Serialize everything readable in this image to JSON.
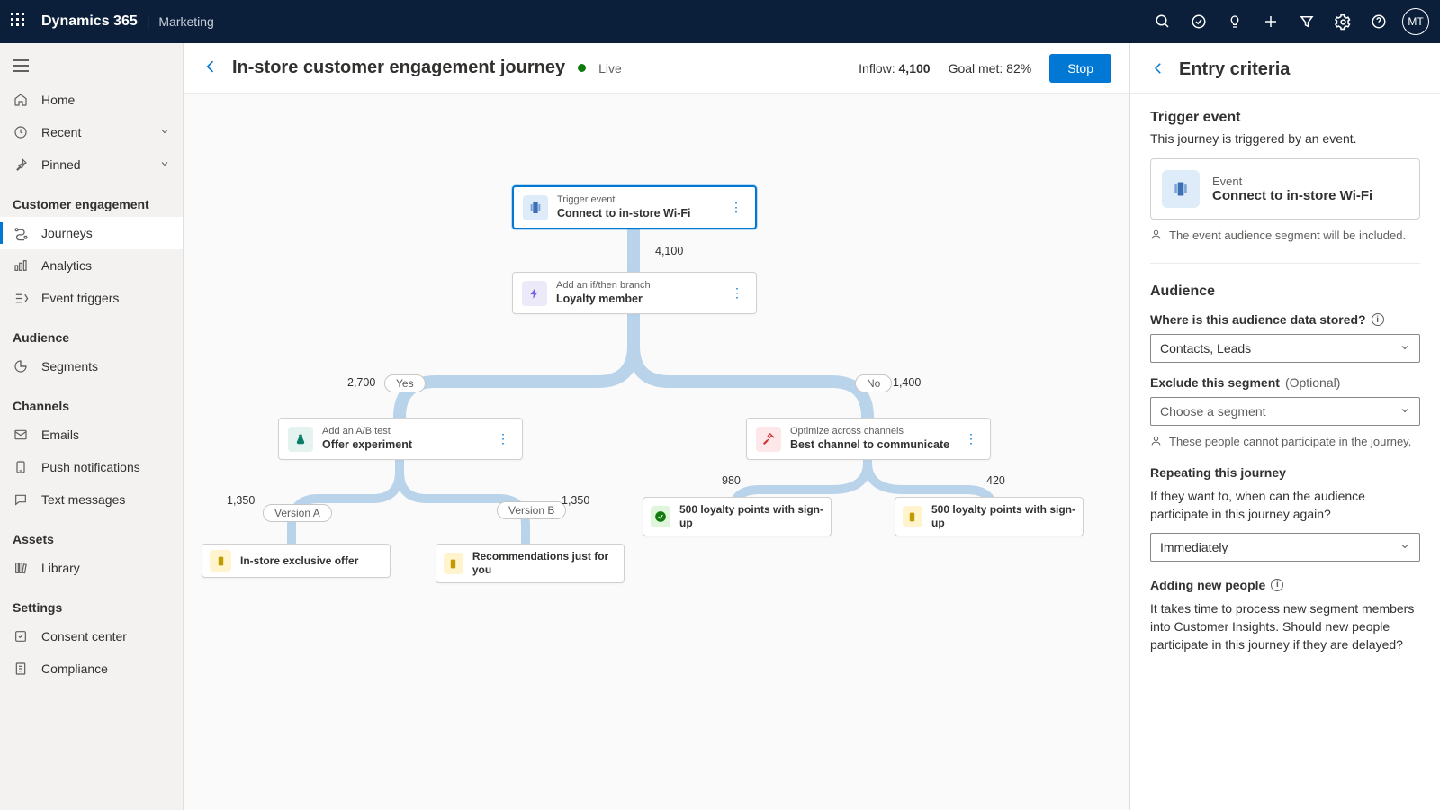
{
  "topbar": {
    "brand": "Dynamics 365",
    "subbrand": "Marketing",
    "avatar": "MT"
  },
  "sidebar": {
    "top": [
      {
        "id": "home",
        "label": "Home"
      },
      {
        "id": "recent",
        "label": "Recent",
        "expandable": true
      },
      {
        "id": "pinned",
        "label": "Pinned",
        "expandable": true
      }
    ],
    "sections": [
      {
        "title": "Customer engagement",
        "items": [
          {
            "id": "journeys",
            "label": "Journeys",
            "active": true
          },
          {
            "id": "analytics",
            "label": "Analytics"
          },
          {
            "id": "triggers",
            "label": "Event triggers"
          }
        ]
      },
      {
        "title": "Audience",
        "items": [
          {
            "id": "segments",
            "label": "Segments"
          }
        ]
      },
      {
        "title": "Channels",
        "items": [
          {
            "id": "emails",
            "label": "Emails"
          },
          {
            "id": "push",
            "label": "Push notifications"
          },
          {
            "id": "text",
            "label": "Text messages"
          }
        ]
      },
      {
        "title": "Assets",
        "items": [
          {
            "id": "library",
            "label": "Library"
          }
        ]
      },
      {
        "title": "Settings",
        "items": [
          {
            "id": "consent",
            "label": "Consent center"
          },
          {
            "id": "compliance",
            "label": "Compliance"
          }
        ]
      }
    ]
  },
  "cmdbar": {
    "title": "In-store customer engagement journey",
    "status": "Live",
    "inflow_label": "Inflow:",
    "inflow_value": "4,100",
    "goal_label": "Goal met:",
    "goal_value": "82%",
    "stop": "Stop"
  },
  "canvas": {
    "nodes": {
      "trigger": {
        "type": "Trigger event",
        "title": "Connect to in-store Wi-Fi"
      },
      "cond": {
        "type": "Add an if/then branch",
        "title": "Loyalty member"
      },
      "ab": {
        "type": "Add an A/B test",
        "title": "Offer experiment"
      },
      "opt": {
        "type": "Optimize across channels",
        "title": "Best channel to communicate"
      },
      "va": {
        "title": "In-store exclusive offer"
      },
      "vb": {
        "title": "Recommendations just for you"
      },
      "loy1": {
        "title": "500 loyalty points with sign-up"
      },
      "loy2": {
        "title": "500 loyalty points with sign-up"
      }
    },
    "pills": {
      "yes": "Yes",
      "no": "No",
      "va": "Version A",
      "vb": "Version B"
    },
    "nums": {
      "root": "4,100",
      "yes": "2,700",
      "no": "1,400",
      "va": "1,350",
      "vb": "1,350",
      "o1": "980",
      "o2": "420"
    }
  },
  "panel": {
    "title": "Entry criteria",
    "trigger_hdr": "Trigger event",
    "trigger_sub": "This journey is triggered by an event.",
    "event_type": "Event",
    "event_name": "Connect to in-store Wi-Fi",
    "trigger_note": "The event audience segment will be included.",
    "audience_hdr": "Audience",
    "where_label": "Where is this audience data stored?",
    "where_value": "Contacts, Leads",
    "exclude_label": "Exclude this segment",
    "optional": "(Optional)",
    "exclude_placeholder": "Choose a segment",
    "exclude_note": "These people cannot participate in the journey.",
    "repeat_label": "Repeating this journey",
    "repeat_body": "If they want to, when can the audience participate in this journey again?",
    "repeat_value": "Immediately",
    "adding_label": "Adding new people",
    "adding_body": "It takes time to process new segment members into Customer Insights. Should new people participate in this journey if they are delayed?"
  }
}
